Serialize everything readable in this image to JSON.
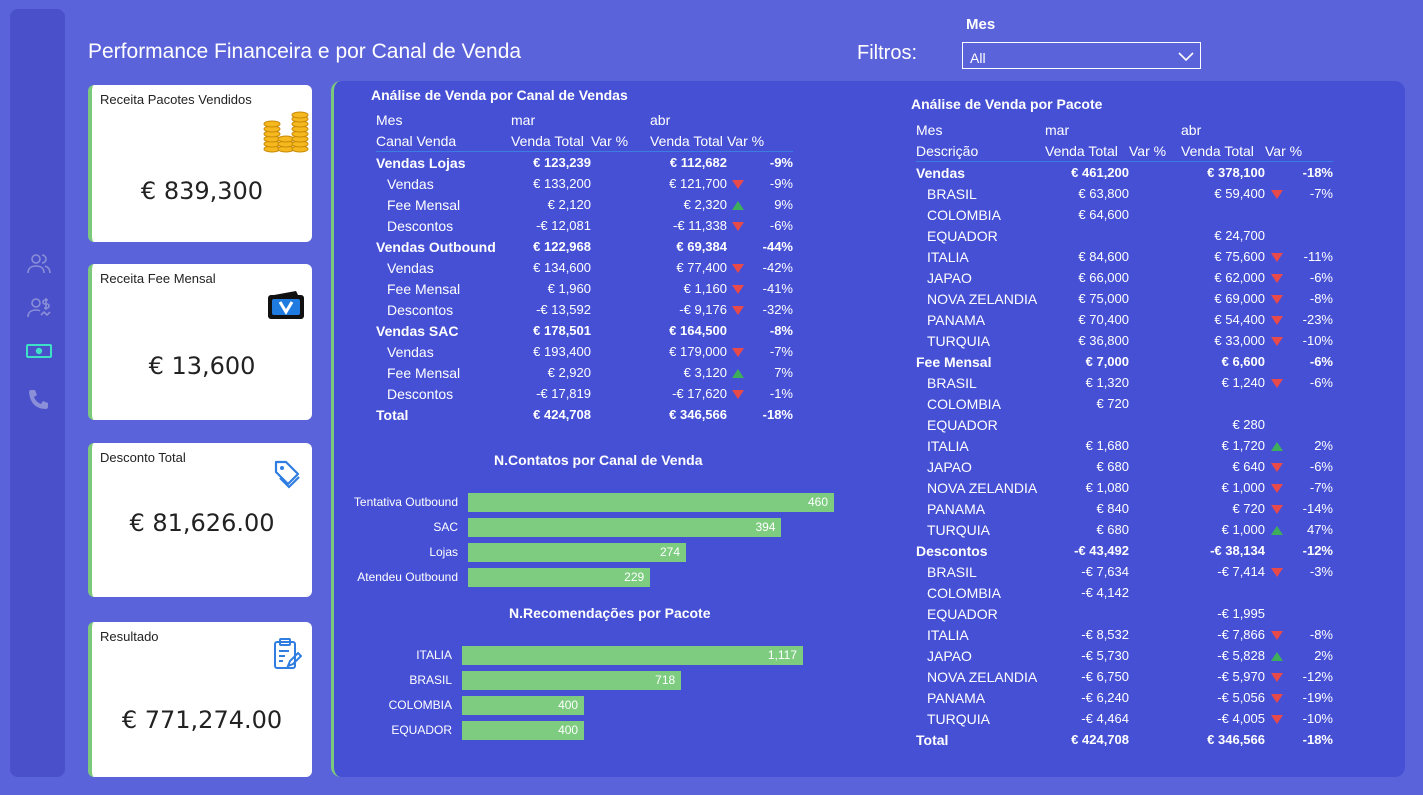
{
  "header": {
    "title": "Performance Financeira e por Canal de Venda",
    "filters_label": "Filtros:",
    "mes_label": "Mes",
    "mes_value": "All"
  },
  "nav": [
    "users-icon",
    "user-dollar-icon",
    "money-icon",
    "phone-icon"
  ],
  "cards": {
    "pacotes": {
      "label": "Receita Pacotes Vendidos",
      "value": "€ 839,300"
    },
    "fee": {
      "label": "Receita Fee Mensal",
      "value": "€ 13,600"
    },
    "desconto": {
      "label": "Desconto Total",
      "value": "€ 81,626.00"
    },
    "resultado": {
      "label": "Resultado",
      "value": "€ 771,274.00"
    }
  },
  "canal": {
    "title": "Análise de Venda por Canal de Vendas",
    "h1": [
      "Mes",
      "mar",
      "",
      "abr",
      ""
    ],
    "h2": [
      "Canal Venda",
      "Venda Total",
      "Var %",
      "Venda Total",
      "Var %"
    ],
    "rows": [
      {
        "l": "Vendas Lojas",
        "b": true,
        "m": "€ 123,239",
        "a": "€ 112,682",
        "t": "",
        "v": "-9%"
      },
      {
        "l": "Vendas",
        "m": "€ 133,200",
        "a": "€ 121,700",
        "t": "down",
        "v": "-9%"
      },
      {
        "l": "Fee Mensal",
        "m": "€ 2,120",
        "a": "€ 2,320",
        "t": "up",
        "v": "9%"
      },
      {
        "l": "Descontos",
        "m": "-€ 12,081",
        "a": "-€ 11,338",
        "t": "down",
        "v": "-6%"
      },
      {
        "l": "Vendas Outbound",
        "b": true,
        "m": "€ 122,968",
        "a": "€ 69,384",
        "t": "",
        "v": "-44%"
      },
      {
        "l": "Vendas",
        "m": "€ 134,600",
        "a": "€ 77,400",
        "t": "down",
        "v": "-42%"
      },
      {
        "l": "Fee Mensal",
        "m": "€ 1,960",
        "a": "€ 1,160",
        "t": "down",
        "v": "-41%"
      },
      {
        "l": "Descontos",
        "m": "-€ 13,592",
        "a": "-€ 9,176",
        "t": "down",
        "v": "-32%"
      },
      {
        "l": "Vendas SAC",
        "b": true,
        "m": "€ 178,501",
        "a": "€ 164,500",
        "t": "",
        "v": "-8%"
      },
      {
        "l": "Vendas",
        "m": "€ 193,400",
        "a": "€ 179,000",
        "t": "down",
        "v": "-7%"
      },
      {
        "l": "Fee Mensal",
        "m": "€ 2,920",
        "a": "€ 3,120",
        "t": "up",
        "v": "7%"
      },
      {
        "l": "Descontos",
        "m": "-€ 17,819",
        "a": "-€ 17,620",
        "t": "down",
        "v": "-1%"
      },
      {
        "l": "Total",
        "b": true,
        "m": "€ 424,708",
        "a": "€ 346,566",
        "t": "",
        "v": "-18%"
      }
    ]
  },
  "pacote": {
    "title": "Análise de Venda por Pacote",
    "h1": [
      "Mes",
      "mar",
      "",
      "abr",
      ""
    ],
    "h2": [
      "Descrição",
      "Venda Total",
      "Var %",
      "Venda Total",
      "Var %"
    ],
    "rows": [
      {
        "l": "Vendas",
        "b": true,
        "m": "€ 461,200",
        "a": "€ 378,100",
        "t": "",
        "v": "-18%"
      },
      {
        "l": "BRASIL",
        "m": "€ 63,800",
        "a": "€ 59,400",
        "t": "down",
        "v": "-7%"
      },
      {
        "l": "COLOMBIA",
        "m": "€ 64,600",
        "a": "",
        "t": "",
        "v": ""
      },
      {
        "l": "EQUADOR",
        "m": "",
        "a": "€ 24,700",
        "t": "",
        "v": ""
      },
      {
        "l": "ITALIA",
        "m": "€ 84,600",
        "a": "€ 75,600",
        "t": "down",
        "v": "-11%"
      },
      {
        "l": "JAPAO",
        "m": "€ 66,000",
        "a": "€ 62,000",
        "t": "down",
        "v": "-6%"
      },
      {
        "l": "NOVA ZELANDIA",
        "m": "€ 75,000",
        "a": "€ 69,000",
        "t": "down",
        "v": "-8%"
      },
      {
        "l": "PANAMA",
        "m": "€ 70,400",
        "a": "€ 54,400",
        "t": "down",
        "v": "-23%"
      },
      {
        "l": "TURQUIA",
        "m": "€ 36,800",
        "a": "€ 33,000",
        "t": "down",
        "v": "-10%"
      },
      {
        "l": "Fee Mensal",
        "b": true,
        "m": "€ 7,000",
        "a": "€ 6,600",
        "t": "",
        "v": "-6%"
      },
      {
        "l": "BRASIL",
        "m": "€ 1,320",
        "a": "€ 1,240",
        "t": "down",
        "v": "-6%"
      },
      {
        "l": "COLOMBIA",
        "m": "€ 720",
        "a": "",
        "t": "",
        "v": ""
      },
      {
        "l": "EQUADOR",
        "m": "",
        "a": "€ 280",
        "t": "",
        "v": ""
      },
      {
        "l": "ITALIA",
        "m": "€ 1,680",
        "a": "€ 1,720",
        "t": "up",
        "v": "2%"
      },
      {
        "l": "JAPAO",
        "m": "€ 680",
        "a": "€ 640",
        "t": "down",
        "v": "-6%"
      },
      {
        "l": "NOVA ZELANDIA",
        "m": "€ 1,080",
        "a": "€ 1,000",
        "t": "down",
        "v": "-7%"
      },
      {
        "l": "PANAMA",
        "m": "€ 840",
        "a": "€ 720",
        "t": "down",
        "v": "-14%"
      },
      {
        "l": "TURQUIA",
        "m": "€ 680",
        "a": "€ 1,000",
        "t": "up",
        "v": "47%"
      },
      {
        "l": "Descontos",
        "b": true,
        "m": "-€ 43,492",
        "a": "-€ 38,134",
        "t": "",
        "v": "-12%"
      },
      {
        "l": "BRASIL",
        "m": "-€ 7,634",
        "a": "-€ 7,414",
        "t": "down",
        "v": "-3%"
      },
      {
        "l": "COLOMBIA",
        "m": "-€ 4,142",
        "a": "",
        "t": "",
        "v": ""
      },
      {
        "l": "EQUADOR",
        "m": "",
        "a": "-€ 1,995",
        "t": "",
        "v": ""
      },
      {
        "l": "ITALIA",
        "m": "-€ 8,532",
        "a": "-€ 7,866",
        "t": "down",
        "v": "-8%"
      },
      {
        "l": "JAPAO",
        "m": "-€ 5,730",
        "a": "-€ 5,828",
        "t": "up",
        "v": "2%"
      },
      {
        "l": "NOVA ZELANDIA",
        "m": "-€ 6,750",
        "a": "-€ 5,970",
        "t": "down",
        "v": "-12%"
      },
      {
        "l": "PANAMA",
        "m": "-€ 6,240",
        "a": "-€ 5,056",
        "t": "down",
        "v": "-19%"
      },
      {
        "l": "TURQUIA",
        "m": "-€ 4,464",
        "a": "-€ 4,005",
        "t": "down",
        "v": "-10%"
      },
      {
        "l": "Total",
        "b": true,
        "m": "€ 424,708",
        "a": "€ 346,566",
        "t": "",
        "v": "-18%"
      }
    ]
  },
  "colors": {
    "bar": "#7dcc80",
    "up": "#3fae5b",
    "down": "#e84a4a",
    "accent": "#7cc97e"
  },
  "chart_data": [
    {
      "type": "bar",
      "title": "N.Contatos por Canal de Venda",
      "categories": [
        "Tentativa Outbound",
        "SAC",
        "Lojas",
        "Atendeu Outbound"
      ],
      "values": [
        460,
        394,
        274,
        229
      ],
      "labels": [
        "460",
        "394",
        "274",
        "229"
      ],
      "orientation": "horizontal"
    },
    {
      "type": "bar",
      "title": "N.Recomendações por Pacote",
      "categories": [
        "ITALIA",
        "BRASIL",
        "COLOMBIA",
        "EQUADOR"
      ],
      "values": [
        1117,
        718,
        400,
        400
      ],
      "labels": [
        "1,117",
        "718",
        "400",
        "400"
      ],
      "orientation": "horizontal"
    }
  ]
}
